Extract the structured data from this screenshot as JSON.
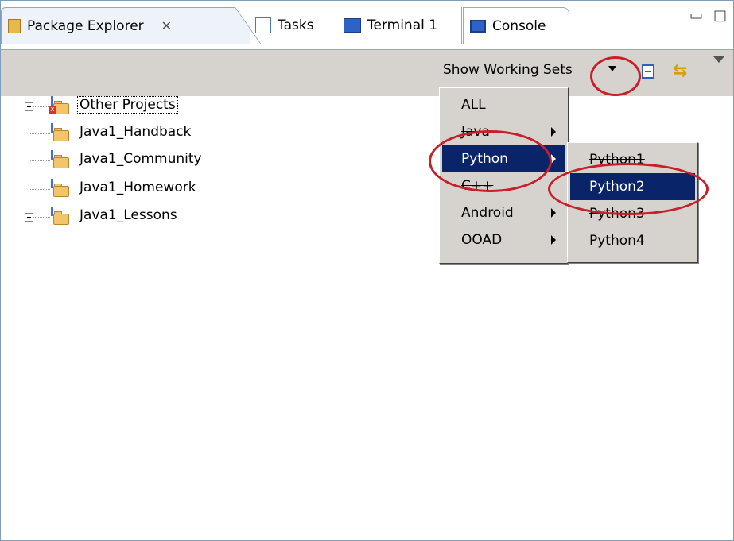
{
  "tabs": [
    {
      "label": "Package Explorer",
      "close": "✕"
    },
    {
      "label": "Tasks"
    },
    {
      "label": "Terminal 1"
    },
    {
      "label": "Console"
    }
  ],
  "toolbar": {
    "show_working_sets": "Show Working Sets"
  },
  "tree": [
    {
      "label": "Other Projects",
      "expandable": true,
      "icon": "folder-error-icon"
    },
    {
      "label": "Java1_Handback",
      "expandable": false,
      "icon": "java-project-icon"
    },
    {
      "label": "Java1_Community",
      "expandable": false,
      "icon": "java-project-icon"
    },
    {
      "label": "Java1_Homework",
      "expandable": false,
      "icon": "java-project-icon"
    },
    {
      "label": "Java1_Lessons",
      "expandable": true,
      "icon": "java-project-icon"
    }
  ],
  "working_sets_menu": [
    {
      "label": "ALL",
      "submenu": false
    },
    {
      "label": "Java",
      "submenu": true
    },
    {
      "label": "Python",
      "submenu": true,
      "selected": true
    },
    {
      "label": "C++",
      "submenu": false
    },
    {
      "label": "Android",
      "submenu": true
    },
    {
      "label": "OOAD",
      "submenu": true
    }
  ],
  "python_submenu": [
    {
      "label": "Python1"
    },
    {
      "label": "Python2",
      "selected": true
    },
    {
      "label": "Python3"
    },
    {
      "label": "Python4"
    }
  ],
  "colors": {
    "selection": "#0a246a",
    "annotation": "#c8202a",
    "menu_bg": "#d6d3ce"
  }
}
